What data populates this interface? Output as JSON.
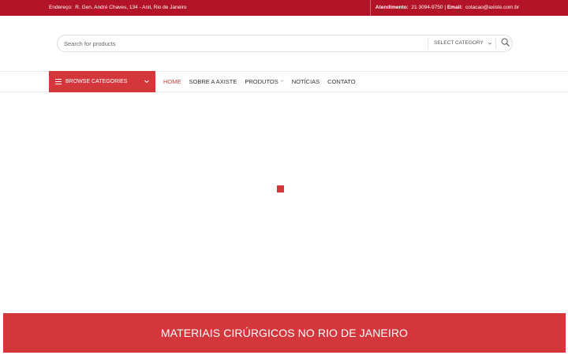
{
  "topbar": {
    "address_label": "Endereço:",
    "address": "R. Gen. André Chaves, 134 - Anil, Rio de Janeiro",
    "phone_label": "Atendimento:",
    "phone": "21 3094-9750",
    "email_label": "Email:",
    "email": "cotacao@axiste.com.br",
    "separator": "|",
    "background_color": "#b31326"
  },
  "search": {
    "placeholder": "Search for products",
    "category_label": "SELECT CATEGORY",
    "category_icon": "chevron-down-icon",
    "button_icon": "search-icon"
  },
  "nav": {
    "browse_label": "BROWSE CATEGORIES",
    "browse_icon": "hamburger-icon",
    "accent_color": "#d4373b",
    "items": [
      {
        "label": "HOME",
        "active": true
      },
      {
        "label": "SOBRE A AXISTE",
        "active": false
      },
      {
        "label": "PRODUTOS",
        "active": false,
        "has_dropdown": true
      },
      {
        "label": "NOTÍCIAS",
        "active": false
      },
      {
        "label": "CONTATO",
        "active": false
      }
    ]
  },
  "main": {
    "loader_icon": "loading-square-icon"
  },
  "banner": {
    "title": "MATERIAIS CIRÚRGICOS NO RIO DE JANEIRO"
  }
}
